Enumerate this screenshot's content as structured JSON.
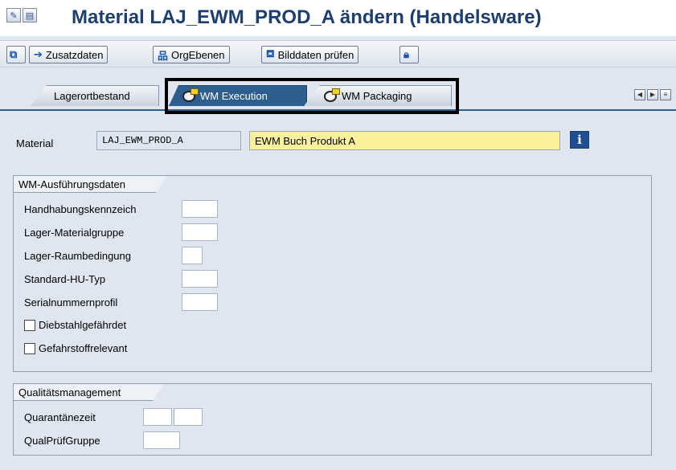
{
  "window": {
    "title": "Material LAJ_EWM_PROD_A ändern (Handelsware)"
  },
  "toolbar": {
    "zusatzdaten": "Zusatzdaten",
    "orgebenen": "OrgEbenen",
    "bilddaten": "Bilddaten prüfen"
  },
  "tabs": [
    {
      "label": "Lagerortbestand",
      "active": false
    },
    {
      "label": "WM Execution",
      "active": true
    },
    {
      "label": "WM Packaging",
      "active": false
    }
  ],
  "material": {
    "label": "Material",
    "value": "LAJ_EWM_PROD_A",
    "description": "EWM Buch Produkt A"
  },
  "wm_group": {
    "title": "WM-Ausführungsdaten",
    "fields": [
      {
        "label": "Handhabungskennzeich",
        "value": ""
      },
      {
        "label": "Lager-Materialgruppe",
        "value": ""
      },
      {
        "label": "Lager-Raumbedingung",
        "value": ""
      },
      {
        "label": "Standard-HU-Typ",
        "value": ""
      },
      {
        "label": "Serialnummernprofil",
        "value": ""
      }
    ],
    "checkboxes": [
      {
        "label": "Diebstahlgefährdet",
        "checked": false
      },
      {
        "label": "Gefahrstoffrelevant",
        "checked": false
      }
    ]
  },
  "qm_group": {
    "title": "Qualitätsmanagement",
    "fields": [
      {
        "label": "Quarantänezeit",
        "value": ""
      },
      {
        "label": "QualPrüfGruppe",
        "value": ""
      }
    ]
  },
  "colors": {
    "title": "#1e3f6e",
    "active_tab": "#2e5e8e",
    "description_field": "#fbf09c",
    "readonly_field": "#dde6f1",
    "background": "#dfe6ef"
  }
}
